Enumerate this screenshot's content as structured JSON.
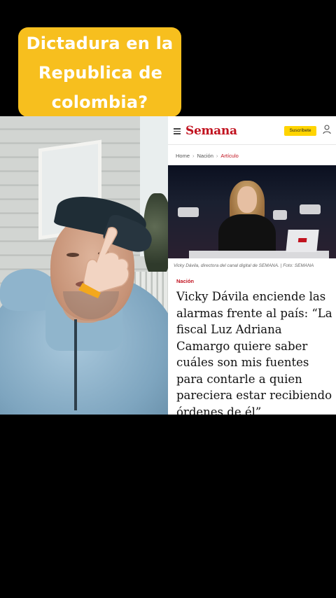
{
  "caption": {
    "line1": "Dictadura en la",
    "line2": "Republica  de",
    "line3": "colombia?"
  },
  "article": {
    "logo": "Semana",
    "subscribe_label": "Suscríbete",
    "breadcrumb": [
      "Home",
      "Nación",
      "Artículo"
    ],
    "photo_caption": "Vicky Dávila, directora del canal digital de SEMANA. | Foto: SEMANA",
    "section": "Nación",
    "headline": "Vicky Dávila enciende las alarmas frente al país: “La fiscal Luz Adriana Camargo quiere saber cuáles son mis fuentes para contarle a quien pareciera estar recibiendo órdenes de él”"
  },
  "colors": {
    "caption_bg": "#f7bf1e",
    "brand_red": "#c1121f",
    "subscribe_bg": "#ffd400"
  },
  "icons": [
    "menu-icon",
    "user-icon",
    "pointing-hand-icon"
  ]
}
